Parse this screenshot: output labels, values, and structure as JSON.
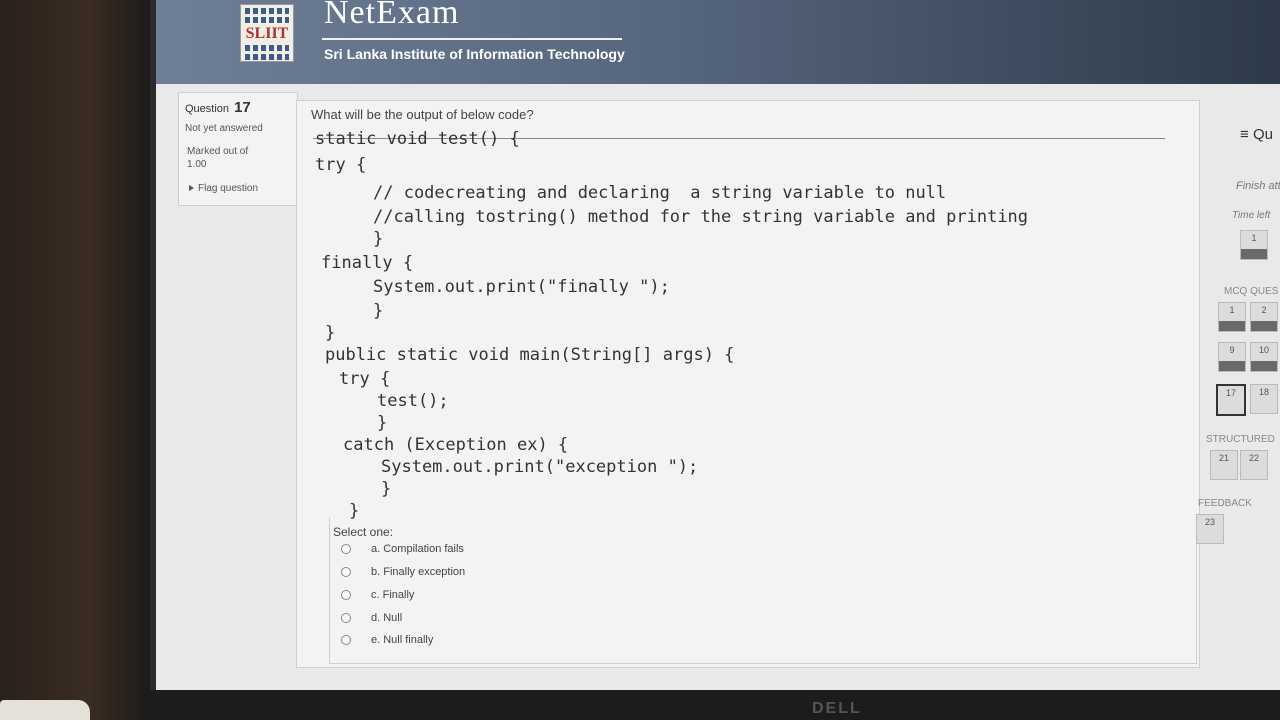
{
  "header": {
    "logo_text": "SLIIT",
    "brand": "NetExam",
    "institute": "Sri Lanka Institute of Information Technology"
  },
  "question_info": {
    "label": "Question",
    "number": "17",
    "state": "Not yet answered",
    "marks_label": "Marked out of",
    "marks_value": "1.00",
    "flag_label": "Flag question"
  },
  "question": {
    "prompt": "What will be the output of below code?",
    "code_lines": [
      "static void test() {",
      "try {",
      "// codecreating and declaring  a string variable to null",
      "//calling tostring() method for the string variable and printing",
      "}",
      "finally {",
      "System.out.print(\"finally \");",
      "}",
      "}",
      "public static void main(String[] args) {",
      "try {",
      "test();",
      "}",
      "catch (Exception ex) {",
      "System.out.print(\"exception \");",
      "}",
      "}"
    ],
    "select_label": "Select one:",
    "options": [
      "a. Compilation fails",
      "b. Finally exception",
      "c. Finally",
      "d. Null",
      "e. Null finally"
    ]
  },
  "navigation": {
    "title": "Qu",
    "finish_label": "Finish att",
    "time_left_label": "Time left",
    "timer_square": "1",
    "mcq_heading": "MCQ QUES",
    "row1": [
      "1",
      "2"
    ],
    "row2": [
      "9",
      "10"
    ],
    "row3": [
      "17",
      "18"
    ],
    "structured_heading": "STRUCTURED",
    "structured": [
      "21",
      "22"
    ],
    "feedback_heading": "FEEDBACK",
    "feedback": [
      "23"
    ]
  },
  "footer": {
    "monitor_brand": "DELL"
  },
  "colors": {
    "header_start": "#6f7f97",
    "header_end": "#2d3949",
    "page_bg": "#e9e9e9"
  }
}
